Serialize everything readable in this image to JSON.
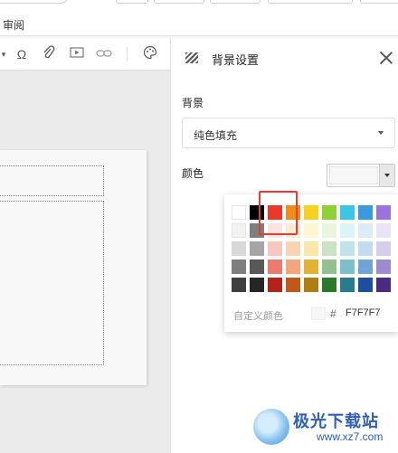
{
  "topbar": {
    "review_label": "审阅"
  },
  "panel": {
    "title": "背景设置",
    "background_label": "背景",
    "fill_select": {
      "value": "纯色填充"
    },
    "color_label": "颜色",
    "current_color": "#F7F7F7"
  },
  "picker": {
    "palette": [
      [
        "#FFFFFF",
        "#000000",
        "#E8392B",
        "#F08C1A",
        "#F7D11E",
        "#8ED236",
        "#3CC6E4",
        "#3A9BDC",
        "#9B73DE"
      ],
      [
        "#F2F2F2",
        "#7F7F7F",
        "#FBE3E0",
        "#FCEBD7",
        "#FDF6D5",
        "#E9F5DC",
        "#DCF3F9",
        "#DDEBF7",
        "#EAE3F6"
      ],
      [
        "#D8D8D8",
        "#A5A5A5",
        "#F7C6BF",
        "#F9D4B3",
        "#F8E7A8",
        "#C9E3C4",
        "#BFE2EB",
        "#C3DAF0",
        "#D6CDEC"
      ],
      [
        "#7F7F7F",
        "#585858",
        "#EC7B6E",
        "#F3A67E",
        "#E3B231",
        "#92C190",
        "#7CC0CC",
        "#6FA4D6",
        "#9E8BCF"
      ],
      [
        "#3F3F3F",
        "#262626",
        "#B4231B",
        "#C05818",
        "#B07D12",
        "#2B7A2C",
        "#2A7C8C",
        "#1F4E9E",
        "#4B2A85"
      ]
    ],
    "custom_label": "自定义颜色",
    "hex_symbol": "#",
    "hex_value": "F7F7F7"
  },
  "watermark": {
    "title": "极光下载站",
    "url": "www.xz7.com"
  }
}
